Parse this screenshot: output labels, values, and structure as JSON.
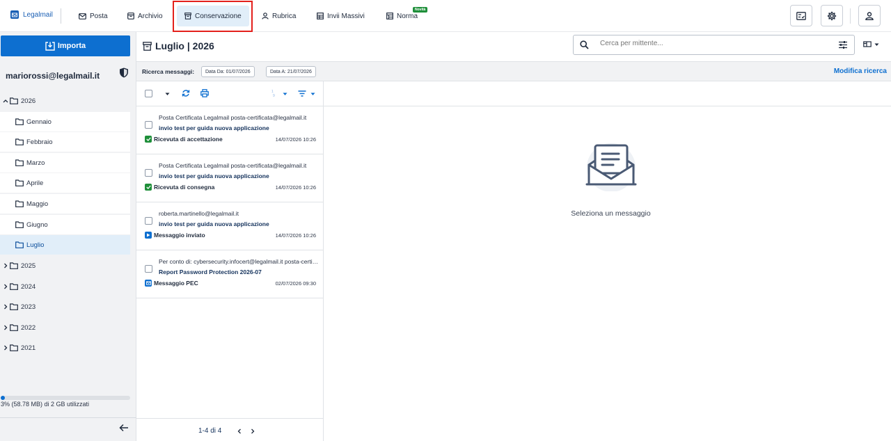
{
  "app": {
    "logo_text": "Legalmail"
  },
  "nav": {
    "items": [
      {
        "label": "Posta"
      },
      {
        "label": "Archivio"
      },
      {
        "label": "Conservazione"
      },
      {
        "label": "Rubrica"
      },
      {
        "label": "Invii Massivi"
      },
      {
        "label": "Norma"
      }
    ],
    "new_badge": "Novità"
  },
  "sidebar": {
    "import_label": "Importa",
    "account": "mariorossi@legalmail.it",
    "tree": [
      {
        "label": "2026",
        "expanded": true
      },
      {
        "label": "Gennaio"
      },
      {
        "label": "Febbraio"
      },
      {
        "label": "Marzo"
      },
      {
        "label": "Aprile"
      },
      {
        "label": "Maggio"
      },
      {
        "label": "Giugno"
      },
      {
        "label": "Luglio",
        "selected": true
      },
      {
        "label": "2025"
      },
      {
        "label": "2024"
      },
      {
        "label": "2023"
      },
      {
        "label": "2022"
      },
      {
        "label": "2021"
      }
    ],
    "storage_percent": 3,
    "storage_text": "3% (58.78 MB) di 2 GB utilizzati"
  },
  "header": {
    "folder_title": "Luglio | 2026",
    "search_placeholder": "Cerca per mittente..."
  },
  "filter": {
    "label": "Ricerca messaggi:",
    "date_from": "Data Da: 01/07/2026",
    "date_to": "Data A: 21/07/2026",
    "modify_label": "Modifica ricerca"
  },
  "messages": [
    {
      "from": "Posta Certificata Legalmail posta-certificata@legalmail.it",
      "subject": "invio test per guida nuova applicazione",
      "status": "Ricevuta di accettazione",
      "status_color": "#1f8f3a",
      "date": "14/07/2026 10:26"
    },
    {
      "from": "Posta Certificata Legalmail posta-certificata@legalmail.it",
      "subject": "invio test per guida nuova applicazione",
      "status": "Ricevuta di consegna",
      "status_color": "#1f8f3a",
      "date": "14/07/2026 10:26"
    },
    {
      "from": "roberta.martinello@legalmail.it",
      "subject": "invio test per guida nuova applicazione",
      "status": "Messaggio inviato",
      "status_color": "#0d6fd0",
      "date": "14/07/2026 10:26"
    },
    {
      "from": "Per conto di: cybersecurity.infocert@legalmail.it posta-certificata",
      "subject": "Report Password Protection 2026-07",
      "status": "Messaggio PEC",
      "status_color": "#0d6fd0",
      "date": "02/07/2026 09:30"
    }
  ],
  "pager": {
    "text": "1-4 di 4"
  },
  "reading": {
    "empty_text": "Seleziona un messaggio"
  },
  "colors": {
    "accent": "#0d6fd0",
    "highlight": "#e3201b",
    "success": "#1f8f3a"
  }
}
